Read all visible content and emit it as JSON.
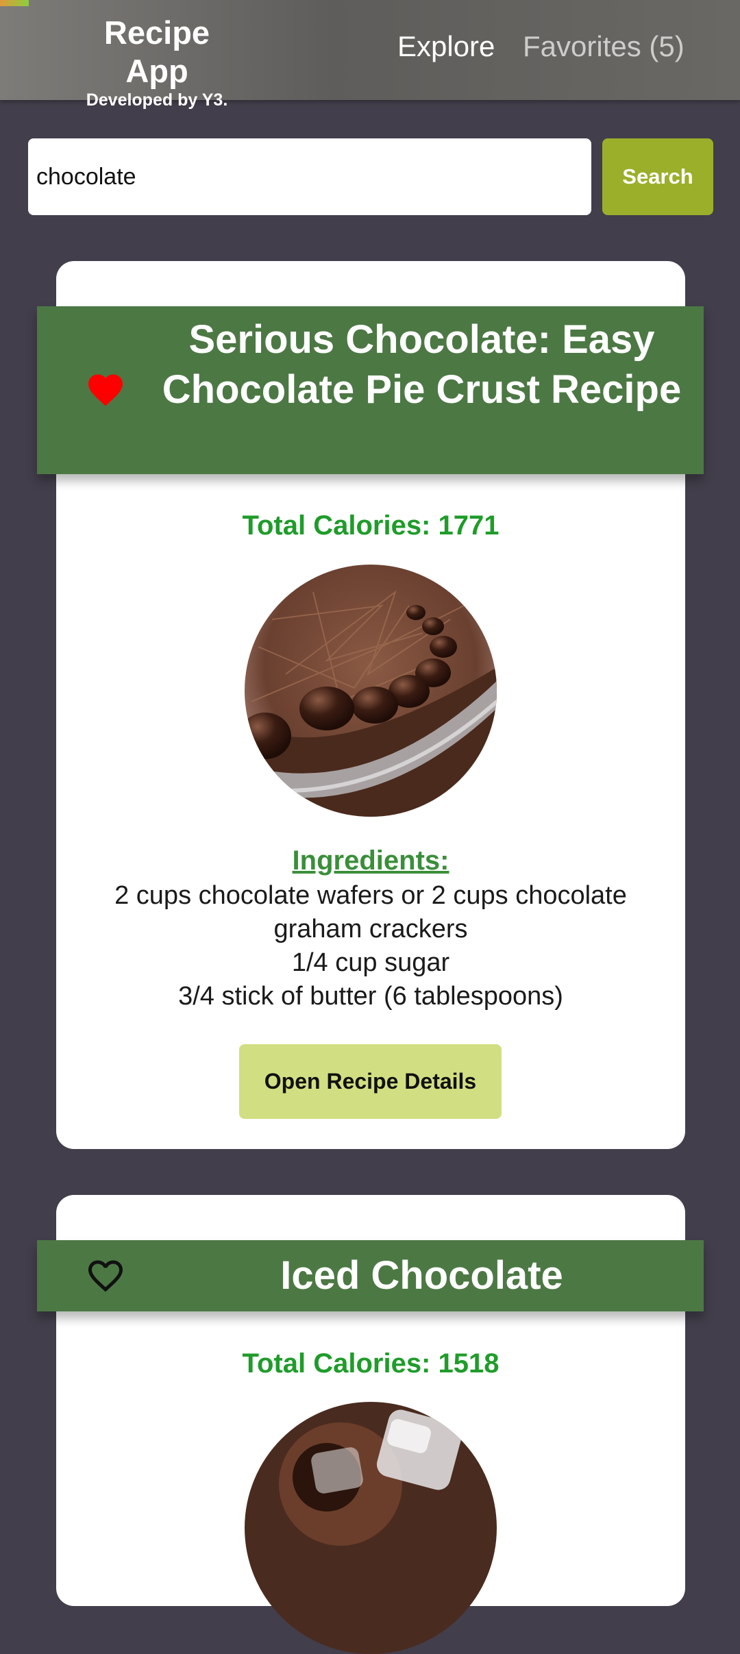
{
  "header": {
    "app_title": "Recipe App",
    "app_subtitle": "Developed by Y3.",
    "nav": {
      "explore_label": "Explore",
      "favorites_label": "Favorites (5)"
    }
  },
  "search": {
    "value": "chocolate",
    "button_label": "Search"
  },
  "recipes": [
    {
      "title": "Serious Chocolate: Easy Chocolate Pie Crust Recipe",
      "favorited": true,
      "calories_text": "Total Calories: 1771",
      "ingredients_heading": "Ingredients:",
      "ingredients": [
        "2 cups chocolate wafers or 2 cups chocolate graham crackers",
        "1/4 cup sugar",
        "3/4 stick of butter (6 tablespoons)"
      ],
      "details_button_label": "Open Recipe Details"
    },
    {
      "title": "Iced Chocolate",
      "favorited": false,
      "calories_text": "Total Calories: 1518"
    }
  ],
  "colors": {
    "page_background": "#423e4b",
    "title_band": "#4c7844",
    "calories_text": "#1f9c2a",
    "search_button": "#9caf2a",
    "details_button": "#d1df82",
    "heart_filled": "#ff0000"
  },
  "icons": {
    "favorite_filled": "heart-filled-icon",
    "favorite_outline": "heart-outline-icon"
  }
}
